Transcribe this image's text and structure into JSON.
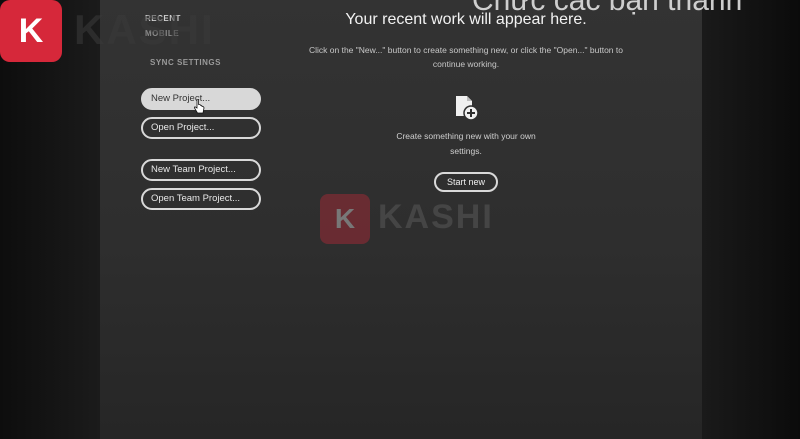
{
  "sidebar": {
    "tab_recent": "RECENT",
    "tab_mobile": "MOBILE",
    "tab_sync": "SYNC SETTINGS",
    "buttons": {
      "new_project": "New Project...",
      "open_project": "Open Project...",
      "new_team_project": "New Team Project...",
      "open_team_project": "Open Team Project..."
    }
  },
  "main": {
    "headline": "Your recent work will appear here.",
    "subline": "Click on the \"New...\" button to create something new, or click the \"Open...\" button to continue working.",
    "create_text": "Create something new with your own settings.",
    "start_new": "Start new",
    "icon": "new-document-plus-icon"
  },
  "overlay": {
    "caption": "Chức các bạn thành",
    "logo_letter": "K",
    "logo_text": "KASHI"
  },
  "colors": {
    "panel": "#303030",
    "brand_red": "#d6283a",
    "button_border": "#d9d9d9"
  }
}
